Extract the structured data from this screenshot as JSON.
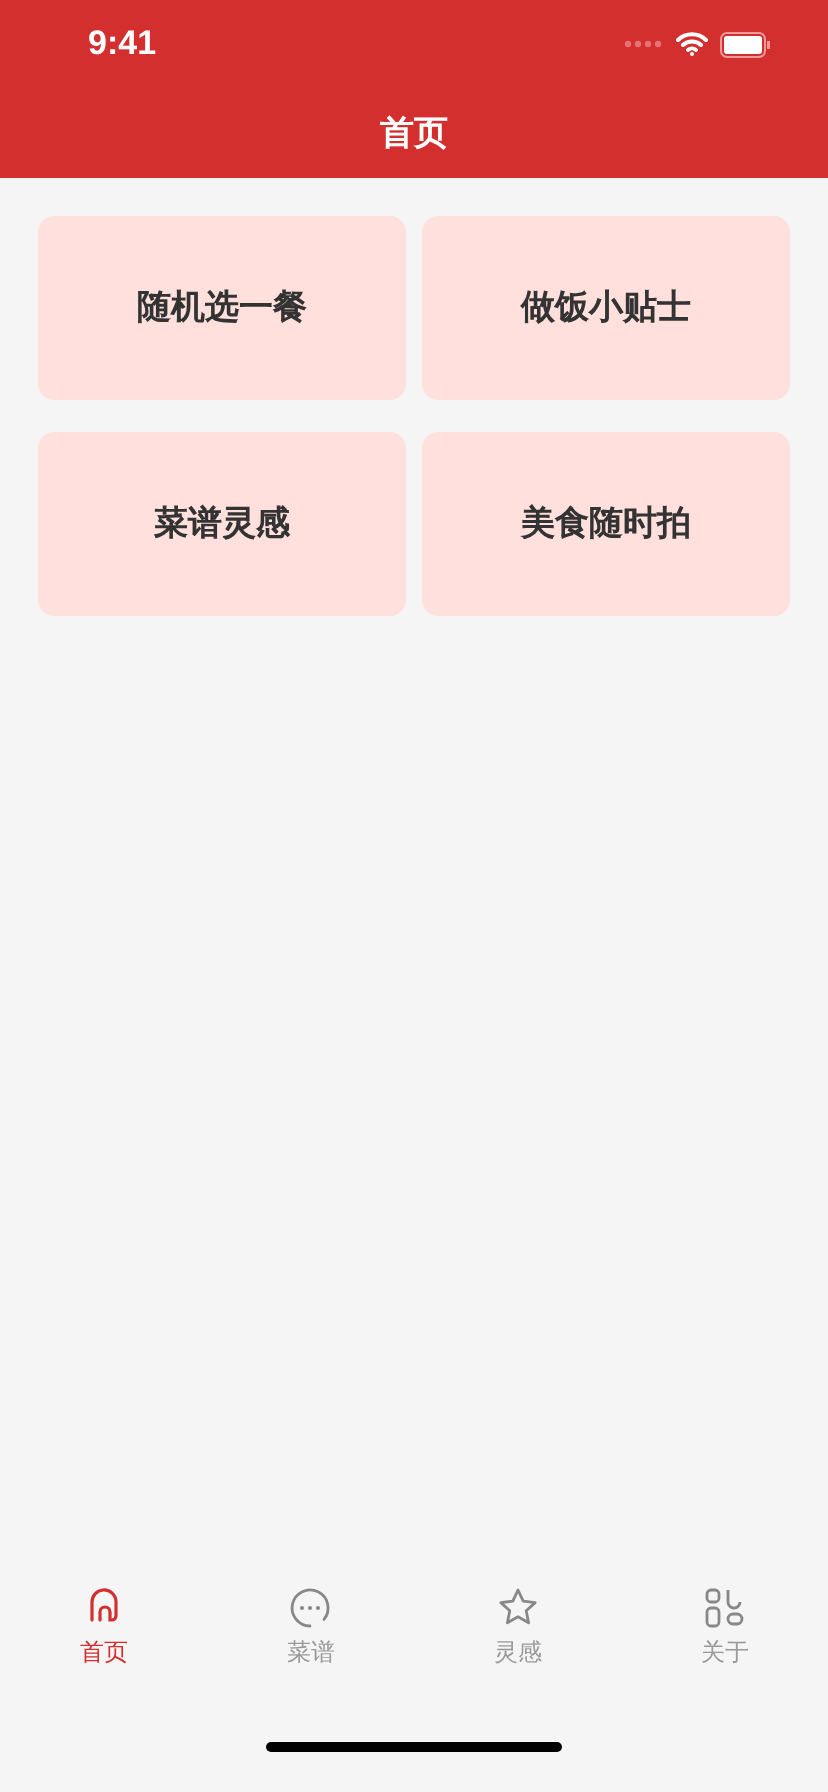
{
  "status_bar": {
    "time": "9:41"
  },
  "nav_bar": {
    "title": "首页"
  },
  "cards": [
    {
      "label": "随机选一餐"
    },
    {
      "label": "做饭小贴士"
    },
    {
      "label": "菜谱灵感"
    },
    {
      "label": "美食随时拍"
    }
  ],
  "tab_bar": [
    {
      "kind": "home",
      "label": "首页",
      "selected": true
    },
    {
      "kind": "chat",
      "label": "菜谱",
      "selected": false
    },
    {
      "kind": "star",
      "label": "灵感",
      "selected": false
    },
    {
      "kind": "grid",
      "label": "关于",
      "selected": false
    }
  ]
}
